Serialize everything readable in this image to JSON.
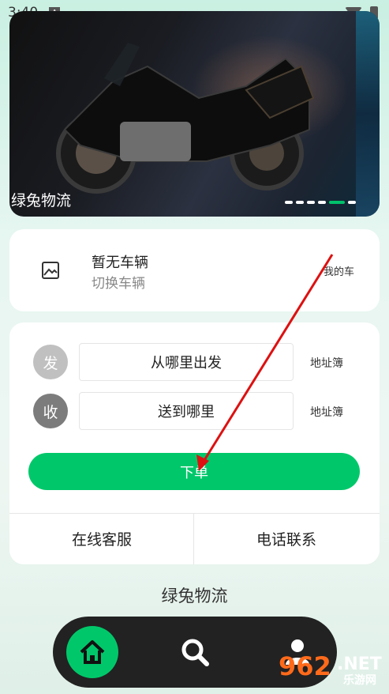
{
  "status_bar": {
    "time": "3:40",
    "notif_glyph": "A"
  },
  "banner": {
    "caption": "绿兔物流",
    "dot_count": 6,
    "active_dot": 4
  },
  "vehicle": {
    "title": "暂无车辆",
    "subtitle": "切换车辆",
    "my_car": "我的车"
  },
  "order": {
    "from_badge": "发",
    "from_placeholder": "从哪里出发",
    "to_badge": "收",
    "to_placeholder": "送到哪里",
    "address_book": "地址簿",
    "submit_label": "下单",
    "online_service": "在线客服",
    "phone_contact": "电话联系"
  },
  "footer": {
    "app_name": "绿兔物流"
  },
  "tabs": [
    {
      "name": "home",
      "icon": "home-icon"
    },
    {
      "name": "search",
      "icon": "search-icon"
    },
    {
      "name": "profile",
      "icon": "user-icon"
    }
  ],
  "watermark": {
    "number": "962",
    "suffix": ".NET",
    "text": "乐游网"
  },
  "colors": {
    "accent": "#00c86a",
    "from_badge": "#c0c0c0",
    "to_badge": "#7c7c7c",
    "tab_bar": "#222222"
  }
}
